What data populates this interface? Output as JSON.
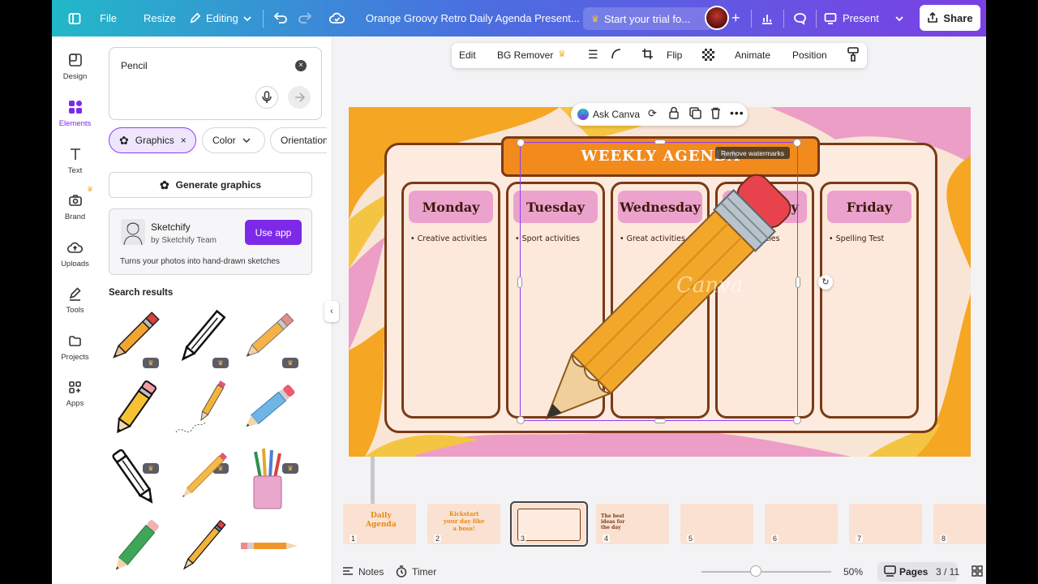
{
  "topbar": {
    "file_label": "File",
    "resize_label": "Resize",
    "editing_label": "Editing",
    "doc_title": "Orange Groovy Retro Daily Agenda Present...",
    "trial_label": "Start your trial fo...",
    "present_label": "Present",
    "share_label": "Share"
  },
  "rail": {
    "items": [
      {
        "label": "Design",
        "icon": "design-icon"
      },
      {
        "label": "Elements",
        "icon": "elements-icon"
      },
      {
        "label": "Text",
        "icon": "text-icon"
      },
      {
        "label": "Brand",
        "icon": "brand-icon"
      },
      {
        "label": "Uploads",
        "icon": "uploads-icon"
      },
      {
        "label": "Tools",
        "icon": "tools-icon"
      },
      {
        "label": "Projects",
        "icon": "projects-icon"
      },
      {
        "label": "Apps",
        "icon": "apps-icon"
      }
    ]
  },
  "panel": {
    "search_value": "Pencil",
    "chips": [
      "Graphics",
      "Color",
      "Orientation"
    ],
    "generate_label": "Generate graphics",
    "app_card": {
      "name": "Sketchify",
      "by": "by Sketchify Team",
      "button": "Use app",
      "description": "Turns your photos into hand-drawn sketches"
    },
    "results_title": "Search results"
  },
  "context_toolbar": {
    "edit": "Edit",
    "bg_remover": "BG Remover",
    "flip": "Flip",
    "animate": "Animate",
    "position": "Position"
  },
  "ask_canva_label": "Ask Canva",
  "watermark_label": "Remove watermarks",
  "slide": {
    "title": "WEEKLY AGENDA",
    "columns": [
      {
        "day": "Monday",
        "item": "• Creative activities"
      },
      {
        "day": "Tuesday",
        "item": "• Sport activities"
      },
      {
        "day": "Wednesday",
        "item": "• Great activities"
      },
      {
        "day": "Thursday",
        "item": "• Art activities"
      },
      {
        "day": "Friday",
        "item": "• Spelling Test"
      }
    ],
    "watermark": "Canva"
  },
  "pages": [
    "1",
    "2",
    "3",
    "4",
    "5",
    "6",
    "7",
    "8"
  ],
  "bottombar": {
    "notes": "Notes",
    "timer": "Timer",
    "zoom": "50%",
    "pages_label": "Pages",
    "page_count": "3 / 11"
  },
  "colors": {
    "accent": "#7d2ae8",
    "selection": "#8b3dff",
    "orange": "#f28a1c",
    "pink": "#eba2cc",
    "brown": "#7a3a16"
  }
}
